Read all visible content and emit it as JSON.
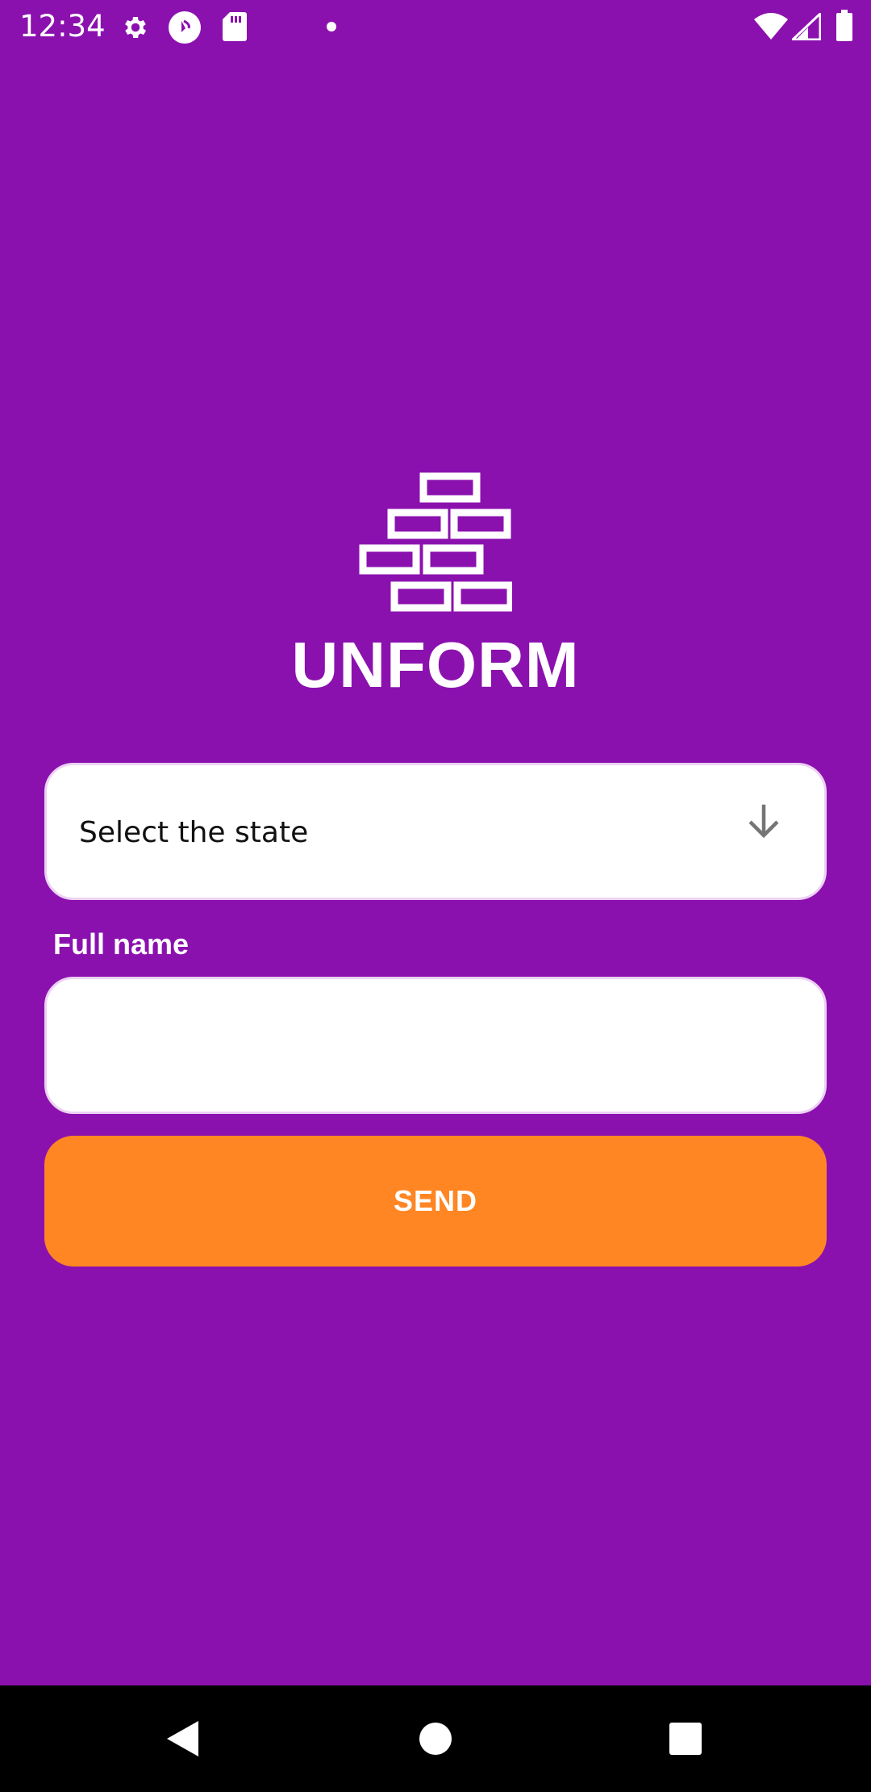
{
  "status_bar": {
    "time": "12:34",
    "icons": [
      "gear-icon",
      "play-protect-icon",
      "sd-card-icon",
      "notification-dot-icon",
      "wifi-icon",
      "signal-icon",
      "battery-icon"
    ]
  },
  "app": {
    "name": "UNFORM",
    "logo_icon": "bricks-icon"
  },
  "form": {
    "state_select": {
      "label": "Select the state",
      "icon": "arrow-down-icon"
    },
    "full_name": {
      "label": "Full name",
      "value": "",
      "placeholder": ""
    },
    "send_label": "SEND"
  },
  "nav_bar": {
    "icons": [
      "back-icon",
      "home-icon",
      "recents-icon"
    ]
  },
  "colors": {
    "background": "#8B11AF",
    "button": "#FF8623",
    "field": "#FFFFFF",
    "text_light": "#FFFFFF"
  }
}
